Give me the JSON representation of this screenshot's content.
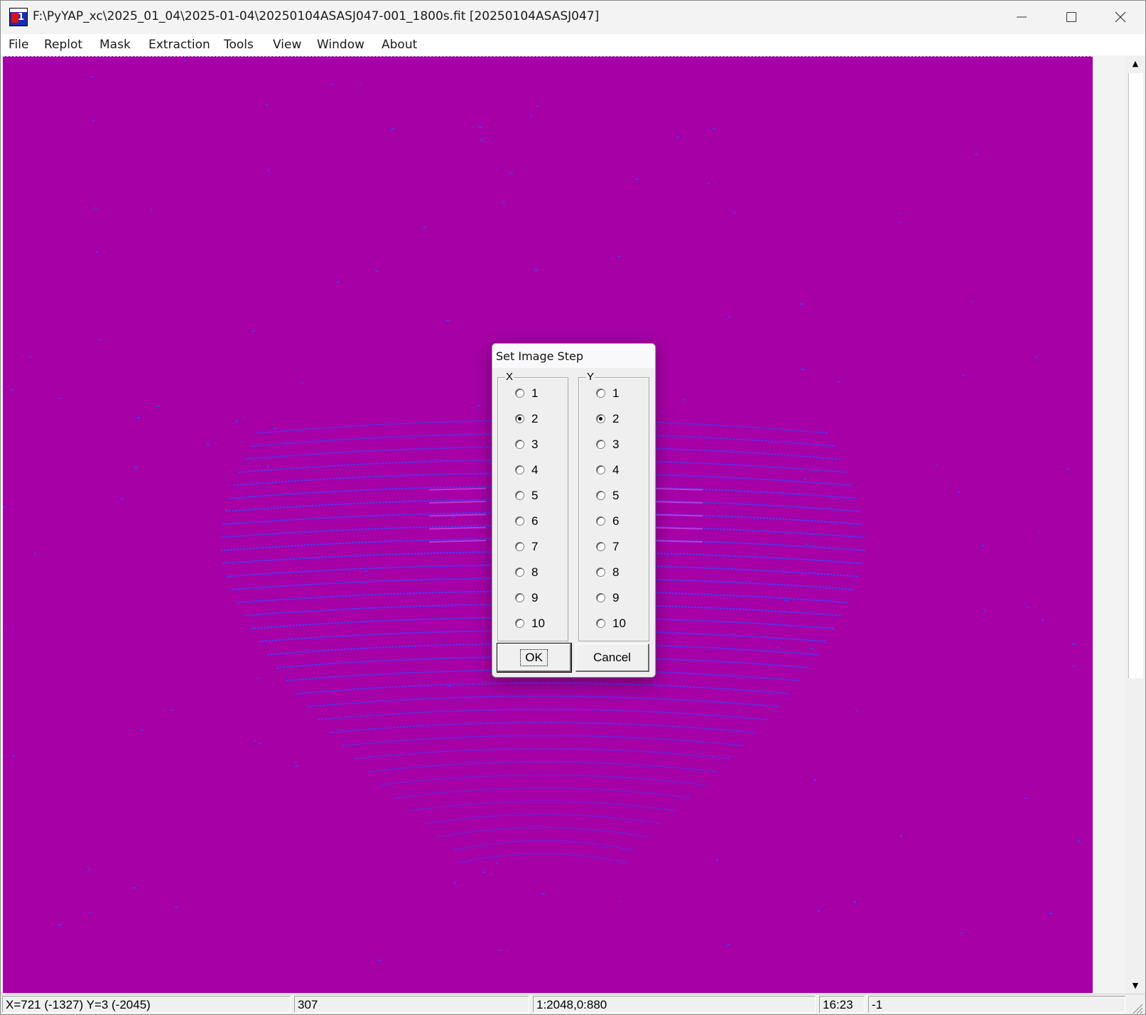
{
  "window": {
    "title": "F:\\PyYAP_xc\\2025_01_04\\2025-01-04\\20250104ASASJ047-001_1800s.fit [20250104ASASJ047]",
    "icon": "app-logo-icon",
    "controls": {
      "minimize": "minimize-icon",
      "maximize": "maximize-icon",
      "close": "close-icon"
    }
  },
  "menu": {
    "items": [
      "File",
      "Replot",
      "Mask",
      "Extraction",
      "Tools",
      "View",
      "Window",
      "About"
    ]
  },
  "image": {
    "background_color": "#a600a6",
    "order_color": "#4b3cf5",
    "hotspot_color": "#d24be6"
  },
  "dialog": {
    "title": "Set Image Step",
    "x_group": {
      "label": "X",
      "options": [
        "1",
        "2",
        "3",
        "4",
        "5",
        "6",
        "7",
        "8",
        "9",
        "10"
      ],
      "selected": "2"
    },
    "y_group": {
      "label": "Y",
      "options": [
        "1",
        "2",
        "3",
        "4",
        "5",
        "6",
        "7",
        "8",
        "9",
        "10"
      ],
      "selected": "2"
    },
    "ok_label": "OK",
    "cancel_label": "Cancel"
  },
  "statusbar": {
    "coords": "X=721 (-1327) Y=3 (-2045)",
    "value": "307",
    "zoom": "1:2048,0:880",
    "time": "16:23",
    "extra": "-1"
  }
}
